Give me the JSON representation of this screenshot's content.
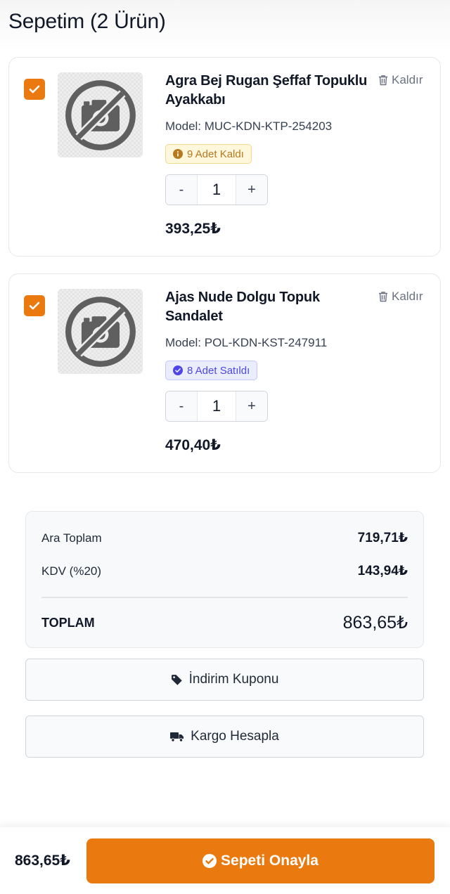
{
  "header": {
    "title": "Sepetim (2 Ürün)"
  },
  "items": [
    {
      "name": "Agra Bej Rugan Şeffaf Topuklu Ayakkabı",
      "remove_label": "Kaldır",
      "model": "Model: MUC-KDN-KTP-254203",
      "badge": "9 Adet Kaldı",
      "quantity": "1",
      "minus": "-",
      "plus": "+",
      "price": "393,25₺",
      "checked": true
    },
    {
      "name": "Ajas Nude Dolgu Topuk Sandalet",
      "remove_label": "Kaldır",
      "model": "Model: POL-KDN-KST-247911",
      "badge": "8 Adet Satıldı",
      "quantity": "1",
      "minus": "-",
      "plus": "+",
      "price": "470,40₺",
      "checked": true
    }
  ],
  "summary": {
    "subtotal_label": "Ara Toplam",
    "subtotal_value": "719,71₺",
    "vat_label": "KDV (%20)",
    "vat_value": "143,94₺",
    "total_label": "TOPLAM",
    "total_value": "863,65₺"
  },
  "actions": {
    "coupon_label": "İndirim Kuponu",
    "shipping_label": "Kargo Hesapla"
  },
  "footer": {
    "total": "863,65₺",
    "confirm_label": "Sepeti Onayla"
  },
  "colors": {
    "accent": "#ea7a10",
    "warn_badge_bg": "#fef7dc",
    "warn_badge_text": "#b7791f",
    "info_badge_bg": "#eaedfd",
    "info_badge_text": "#4f46e5"
  },
  "icons": {
    "checkbox": "check-icon",
    "image_placeholder": "no-photo-icon",
    "remove": "trash-icon",
    "stock_badge": "info-circle-icon",
    "sold_badge": "check-circle-icon",
    "coupon": "tag-icon",
    "shipping": "truck-icon",
    "confirm": "check-circle-icon"
  }
}
